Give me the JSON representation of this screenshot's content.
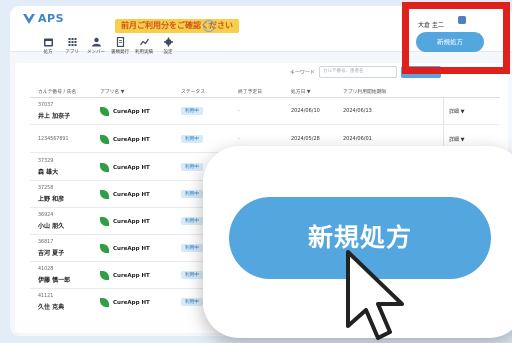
{
  "app": {
    "logo_text": "APS",
    "notice": "前月ご利用分をご確認ください",
    "help_icon": "?",
    "user_name": "大倉 圭二",
    "new_prescription_small": "新規処方",
    "new_prescription_big": "新規処方"
  },
  "nav": [
    {
      "label": "処方",
      "icon": "calendar-icon"
    },
    {
      "label": "アプリ",
      "icon": "grid-icon"
    },
    {
      "label": "メンバー",
      "icon": "users-icon"
    },
    {
      "label": "書類発行",
      "icon": "document-icon"
    },
    {
      "label": "利用実績",
      "icon": "chart-icon"
    },
    {
      "label": "設定",
      "icon": "gear-icon"
    }
  ],
  "search": {
    "label": "キーワード",
    "placeholder": "カルテ番号、患者名"
  },
  "table": {
    "columns": [
      "カルテ番号 / 氏名",
      "アプリ名 ▼",
      "ステータス",
      "終了予定日",
      "処方日 ▼",
      "アプリ利用開始期限"
    ],
    "rows": [
      {
        "id": "37037",
        "name": "井上 加奈子",
        "app": "CureApp HT",
        "status": "利用中",
        "end": "-",
        "rx_date": "2024/06/10",
        "start_limit": "2024/06/13",
        "detail": "詳細 ▼"
      },
      {
        "id": "1234567891",
        "name": "",
        "app": "CureApp HT",
        "status": "利用中",
        "end": "-",
        "rx_date": "2024/05/28",
        "start_limit": "2024/06/01",
        "detail": "詳細 ▼"
      },
      {
        "id": "37329",
        "name": "森 雄大",
        "app": "CureApp HT",
        "status": "利用中",
        "end": "-",
        "rx_date": "",
        "start_limit": "",
        "detail": ""
      },
      {
        "id": "37258",
        "name": "上野 和彦",
        "app": "CureApp HT",
        "status": "利用中",
        "end": "",
        "rx_date": "",
        "start_limit": "",
        "detail": ""
      },
      {
        "id": "36924",
        "name": "小山 朋久",
        "app": "CureApp HT",
        "status": "利用中",
        "end": "",
        "rx_date": "",
        "start_limit": "",
        "detail": ""
      },
      {
        "id": "36817",
        "name": "吉河 夏子",
        "app": "CureApp HT",
        "status": "利用中",
        "end": "",
        "rx_date": "",
        "start_limit": "",
        "detail": ""
      },
      {
        "id": "41028",
        "name": "伊藤 慎一郎",
        "app": "CureApp HT",
        "status": "利用中",
        "end": "",
        "rx_date": "",
        "start_limit": "",
        "detail": ""
      },
      {
        "id": "41121",
        "name": "久住 克典",
        "app": "CureApp HT",
        "status": "利用中",
        "end": "",
        "rx_date": "",
        "start_limit": "",
        "detail": ""
      }
    ]
  },
  "colors": {
    "accent": "#54a6df",
    "highlight": "#e0201a",
    "notice_bg": "#f6cf4c",
    "app_leaf": "#2f9e44"
  }
}
